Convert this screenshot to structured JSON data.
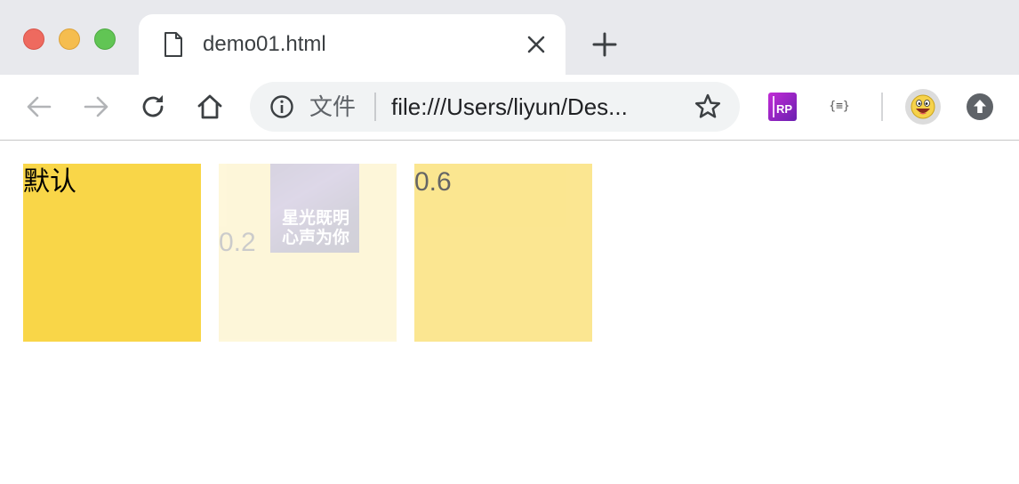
{
  "window": {
    "traffic_lights": [
      "close",
      "minimize",
      "zoom"
    ]
  },
  "tab": {
    "title": "demo01.html",
    "icon": "file-icon"
  },
  "toolbar": {
    "back": "back-arrow-icon",
    "forward": "forward-arrow-icon",
    "reload": "reload-icon",
    "home": "home-icon",
    "omnibox": {
      "security_icon": "info-icon",
      "scheme_label": "文件",
      "url": "file:///Users/liyun/Des..."
    },
    "bookmark": "star-icon",
    "extensions": {
      "rp_label": "RP",
      "json_label": "{≡}"
    },
    "avatar": "smiley-avatar",
    "update": "update-arrow-icon"
  },
  "page": {
    "boxes": [
      {
        "label": "默认",
        "opacity": 1.0,
        "color": "#f9d648"
      },
      {
        "label": "0.2",
        "opacity": 0.2,
        "color": "#f9d648",
        "image_text": [
          "星光既明",
          "心声为你"
        ]
      },
      {
        "label": "0.6",
        "opacity": 0.6,
        "color": "#f9d648"
      }
    ]
  },
  "colors": {
    "tabstrip_bg": "#e8e9ed",
    "omnibox_bg": "#f1f3f4",
    "box_yellow": "#f9d648"
  }
}
